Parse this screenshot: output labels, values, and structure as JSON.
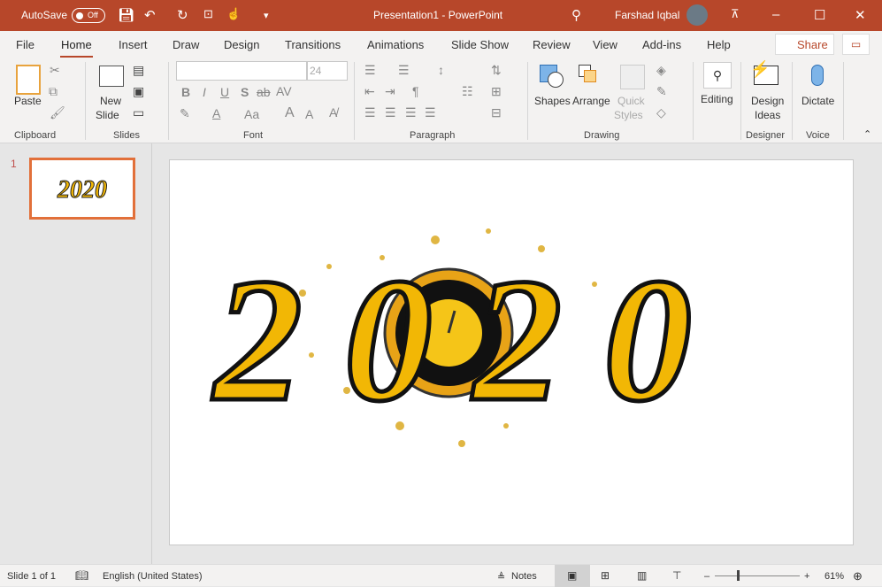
{
  "titlebar": {
    "autosave_label": "AutoSave",
    "autosave_state": "Off",
    "title": "Presentation1  -  PowerPoint",
    "user": "Farshad Iqbal"
  },
  "tabs": [
    {
      "label": "File"
    },
    {
      "label": "Home",
      "active": true
    },
    {
      "label": "Insert"
    },
    {
      "label": "Draw"
    },
    {
      "label": "Design"
    },
    {
      "label": "Transitions"
    },
    {
      "label": "Animations"
    },
    {
      "label": "Slide Show"
    },
    {
      "label": "Review"
    },
    {
      "label": "View"
    },
    {
      "label": "Add-ins"
    },
    {
      "label": "Help"
    }
  ],
  "share_label": "Share",
  "ribbon": {
    "clipboard": {
      "paste": "Paste",
      "group": "Clipboard"
    },
    "slides": {
      "new_slide_1": "New",
      "new_slide_2": "Slide",
      "group": "Slides"
    },
    "font": {
      "font_name": "",
      "font_size": "24",
      "bold": "B",
      "italic": "I",
      "underline": "U",
      "shadow": "S",
      "strike": "ab",
      "spacing": "AV",
      "case": "Aa",
      "grow": "A",
      "shrink": "A",
      "group": "Font"
    },
    "paragraph": {
      "group": "Paragraph"
    },
    "drawing": {
      "shapes": "Shapes",
      "arrange": "Arrange",
      "quick1": "Quick",
      "quick2": "Styles",
      "group": "Drawing"
    },
    "editing": {
      "label": "Editing"
    },
    "designer": {
      "label1": "Design",
      "label2": "Ideas",
      "group": "Designer"
    },
    "voice": {
      "label": "Dictate",
      "group": "Voice"
    }
  },
  "thumbnails": [
    {
      "number": "1"
    }
  ],
  "slide": {
    "image_text": "2020"
  },
  "status": {
    "slide": "Slide 1 of 1",
    "language": "English (United States)",
    "notes": "Notes",
    "zoom": "61%",
    "zoom_percent": 61
  },
  "colors": {
    "accent": "#b7472a",
    "thumb_border": "#e2703a",
    "gold": "#f2b705"
  }
}
